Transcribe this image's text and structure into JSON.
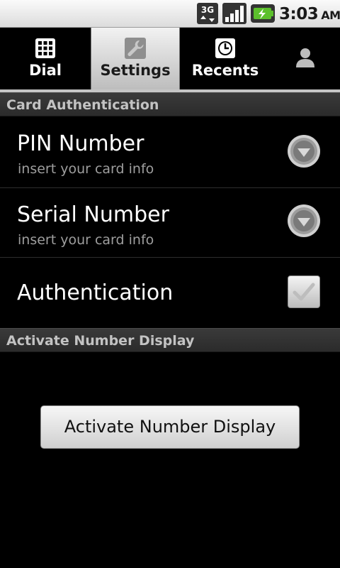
{
  "status_bar": {
    "network": "3G",
    "time": "3:03",
    "ampm": "AM",
    "icons": [
      "3g-data-icon",
      "signal-strength-icon",
      "battery-charging-icon"
    ]
  },
  "tabs": [
    {
      "label": "Dial",
      "icon": "dialpad-icon",
      "selected": false
    },
    {
      "label": "Settings",
      "icon": "wrench-icon",
      "selected": true
    },
    {
      "label": "Recents",
      "icon": "clock-icon",
      "selected": false
    },
    {
      "label": "",
      "icon": "contact-person-icon",
      "selected": false
    }
  ],
  "sections": {
    "card_auth": {
      "header": "Card Authentication",
      "pin": {
        "title": "PIN Number",
        "summary": "insert your card info"
      },
      "serial": {
        "title": "Serial Number",
        "summary": "insert your card info"
      },
      "authentication": {
        "title": "Authentication",
        "checked": true
      }
    },
    "activate": {
      "header": "Activate Number Display",
      "button_label": "Activate Number Display"
    }
  }
}
